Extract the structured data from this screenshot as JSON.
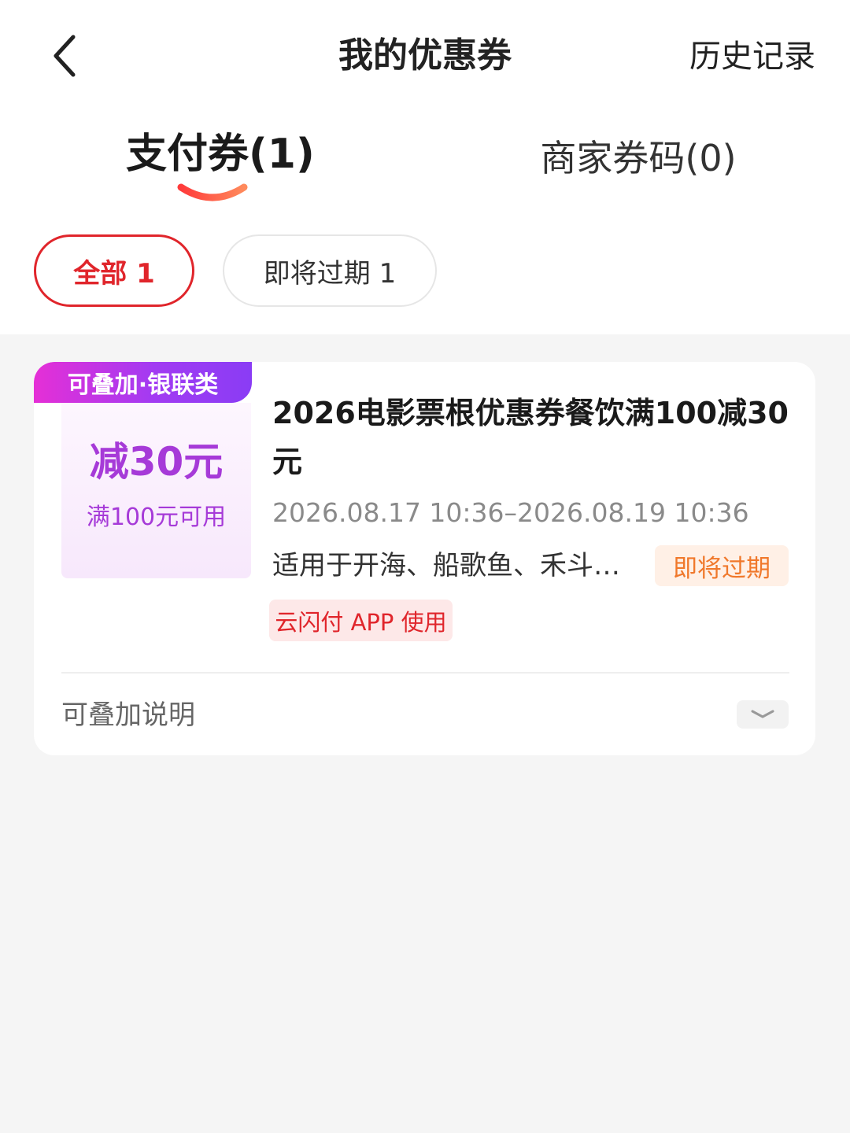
{
  "header": {
    "title": "我的优惠券",
    "history_label": "历史记录",
    "back_icon": "chevron-left-icon"
  },
  "tabs": [
    {
      "label": "支付券(1)",
      "active": true
    },
    {
      "label": "商家券码(0)",
      "active": false
    }
  ],
  "filters": [
    {
      "label": "全部 1",
      "active": true
    },
    {
      "label": "即将过期 1",
      "active": false
    }
  ],
  "coupon": {
    "tag": "可叠加·银联类",
    "amount": "减30元",
    "threshold": "满100元可用",
    "title": "2026电影票根优惠券餐饮满100减30元",
    "validity": "2026.08.17 10:36–2026.08.19 10:36",
    "scope": "适用于开海、船歌鱼、禾斗…",
    "expire_badge": "即将过期",
    "app_badge": "云闪付 APP 使用",
    "stack_explain_label": "可叠加说明",
    "expand_icon": "chevron-down-icon"
  },
  "colors": {
    "accent_red": "#e0252b",
    "coupon_purple": "#a63ad8",
    "expire_orange": "#f0782b",
    "page_bg": "#f5f5f5"
  }
}
